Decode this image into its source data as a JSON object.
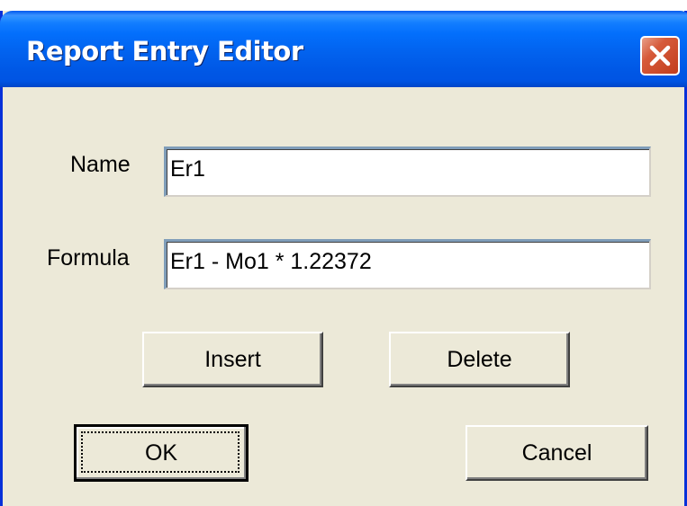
{
  "window": {
    "title": "Report Entry Editor",
    "close_icon": "close-x-icon",
    "accent_color": "#0054e3",
    "close_color": "#c23d1c"
  },
  "form": {
    "name_label": "Name",
    "name_value": "Er1",
    "formula_label": "Formula",
    "formula_value": "Er1 - Mo1 * 1.22372"
  },
  "buttons": {
    "insert": "Insert",
    "delete": "Delete",
    "ok": "OK",
    "cancel": "Cancel"
  }
}
